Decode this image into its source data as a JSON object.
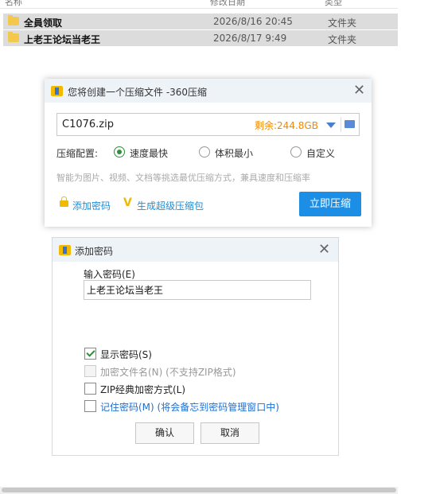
{
  "explorer": {
    "columns": [
      "名称",
      "修改日期",
      "类型"
    ],
    "rows": [
      {
        "name": "全員领取",
        "date": "2026/8/16 20:45",
        "type": "文件夹"
      },
      {
        "name": "上老王论坛当老王",
        "date": "2026/8/17 9:49",
        "type": "文件夹"
      }
    ]
  },
  "compress_dialog": {
    "title": "您将创建一个压缩文件 -360压缩",
    "filename": "C1076.zip",
    "space_remaining": "剩余:244.8GB",
    "config_label": "压缩配置:",
    "options": [
      "速度最快",
      "体积最小",
      "自定义"
    ],
    "selected_option": "速度最快",
    "hint": "智能为图片、视频、文档等挑选最优压缩方式，兼具速度和压缩率",
    "add_password": "添加密码",
    "super_package": "生成超级压缩包",
    "compress_button": "立即压缩"
  },
  "password_dialog": {
    "title": "添加密码",
    "input_label": "输入密码(E)",
    "password_value": "上老王论坛当老王",
    "show_password": "显示密码(S)",
    "encrypt_filenames": "加密文件名(N) (不支持ZIP格式)",
    "zip_classic": "ZIP经典加密方式(L)",
    "remember_password": "记住密码(M) (将会备忘到密码管理窗口中)",
    "ok": "确认",
    "cancel": "取消"
  },
  "colors": {
    "accent_blue": "#1d8ee6",
    "space_orange": "#f08a00",
    "radio_green": "#2f8f3a"
  }
}
